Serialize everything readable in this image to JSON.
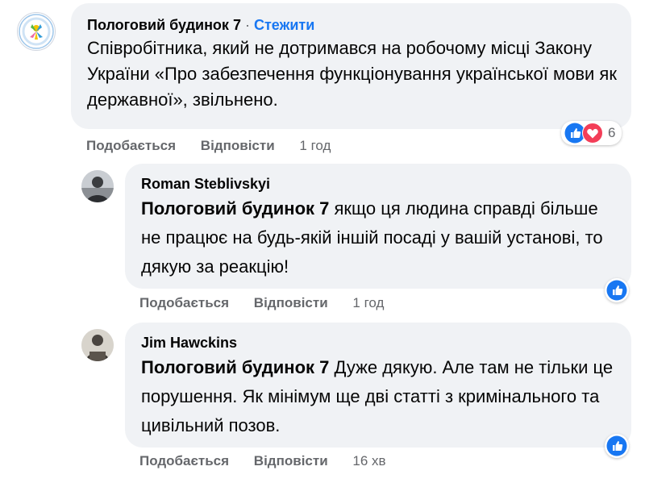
{
  "comment1": {
    "author": "Пологовий будинок 7",
    "dot": "·",
    "follow_label": "Стежити",
    "text": "Співробітника, який не дотримався на робочому місці Закону України «Про забезпечення функціонування української мови як державної», звільнено.",
    "like_label": "Подобається",
    "reply_label": "Відповісти",
    "time": "1 год",
    "reactions": [
      "like-icon",
      "love-icon"
    ],
    "reaction_count": "6"
  },
  "comment2": {
    "author": "Roman Steblivskyi",
    "mention": "Пологовий будинок 7",
    "text": " якщо ця людина справді більше не працює на будь-якій іншій посаді у вашій установі, то дякую за реакцію!",
    "like_label": "Подобається",
    "reply_label": "Відповісти",
    "time": "1 год",
    "reactions": [
      "like-icon"
    ]
  },
  "comment3": {
    "author": "Jim Hawckins",
    "mention": "Пологовий будинок 7",
    "text": " Дуже дякую. Але там не тільки це порушення. Як мінімум ще дві статті з кримінального та цивільний позов.",
    "like_label": "Подобається",
    "reply_label": "Відповісти",
    "time": "16 хв",
    "reactions": [
      "like-icon"
    ]
  },
  "colors": {
    "bubble": "#f0f2f5",
    "link": "#1877f2",
    "muted": "#65676b",
    "like": "#1877f2",
    "love": "#f33e58"
  }
}
